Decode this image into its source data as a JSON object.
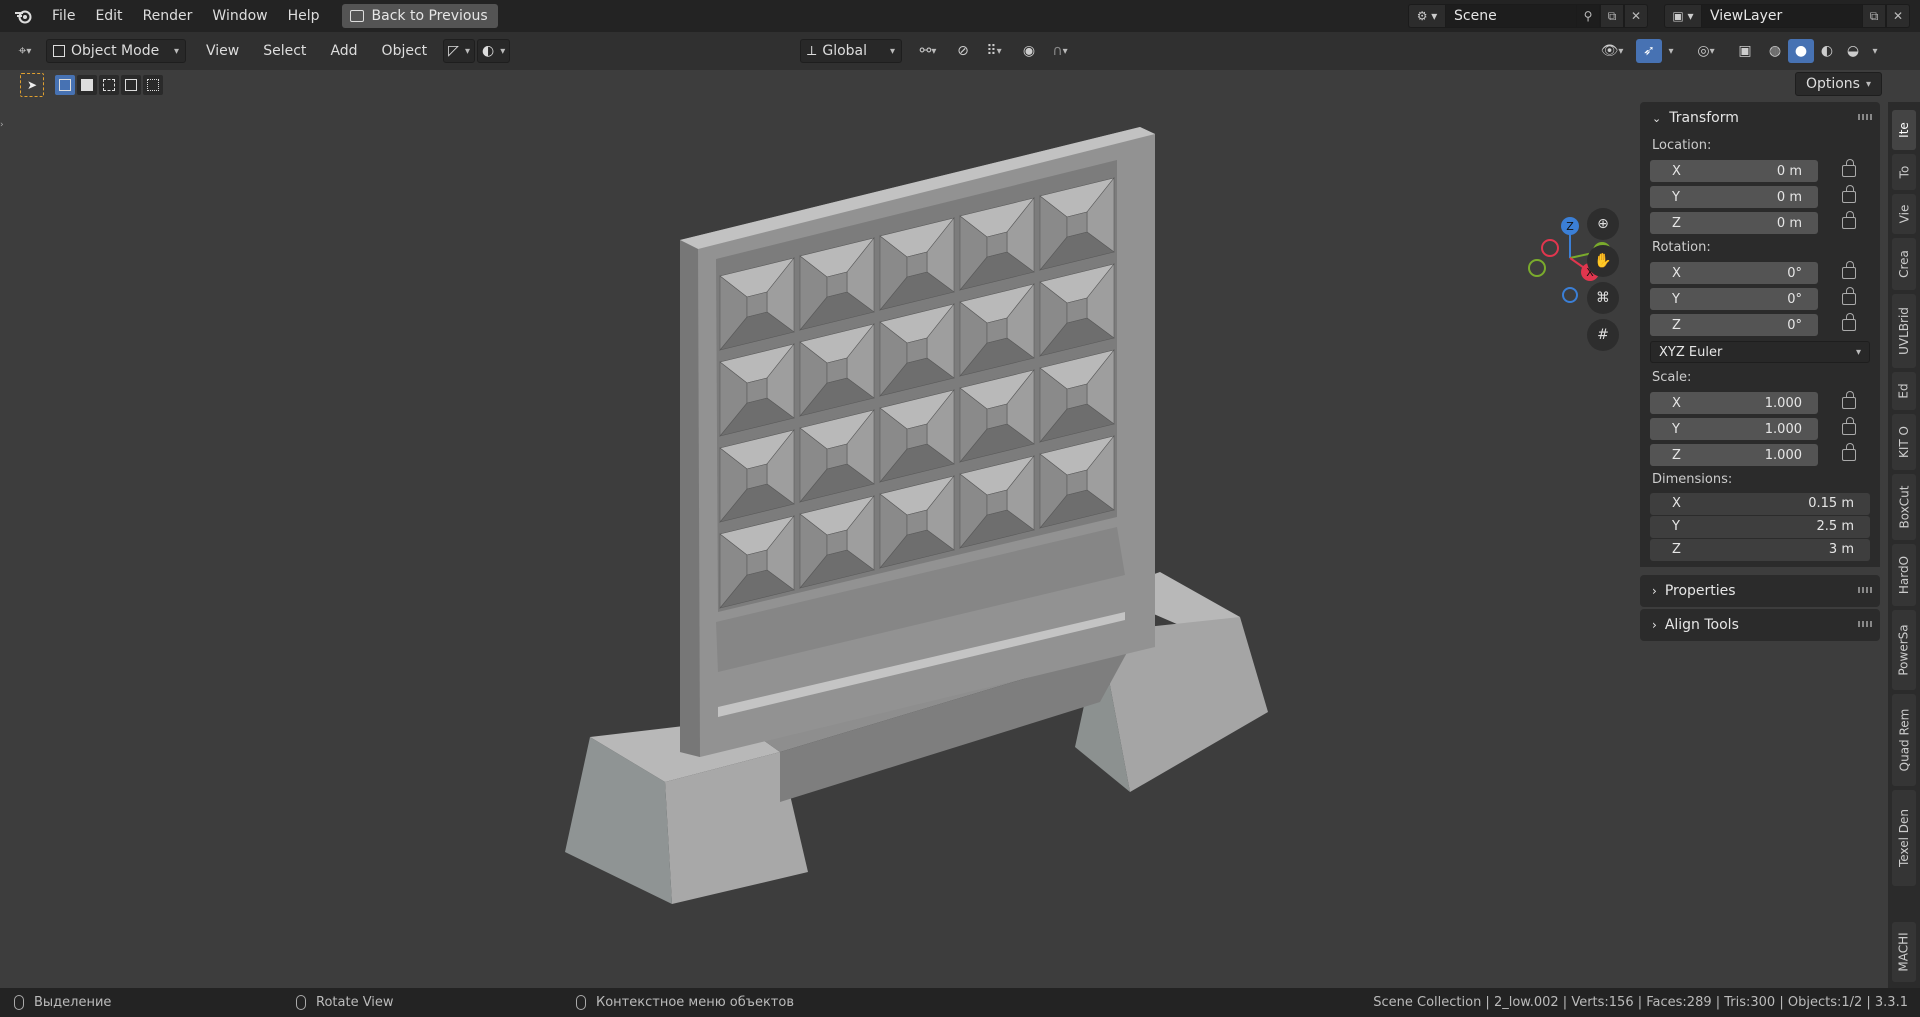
{
  "topbar": {
    "menu": [
      "File",
      "Edit",
      "Render",
      "Window",
      "Help"
    ],
    "back_label": "Back to Previous",
    "scene": "Scene",
    "view_layer": "ViewLayer"
  },
  "header": {
    "mode": "Object Mode",
    "menu": [
      "View",
      "Select",
      "Add",
      "Object"
    ],
    "orientation": "Global",
    "options": "Options"
  },
  "gizmo": {
    "x": "X",
    "y": "Y",
    "z": "Z"
  },
  "npanel": {
    "transform_title": "Transform",
    "location_label": "Location:",
    "location": [
      {
        "axis": "X",
        "value": "0 m"
      },
      {
        "axis": "Y",
        "value": "0 m"
      },
      {
        "axis": "Z",
        "value": "0 m"
      }
    ],
    "rotation_label": "Rotation:",
    "rotation": [
      {
        "axis": "X",
        "value": "0°"
      },
      {
        "axis": "Y",
        "value": "0°"
      },
      {
        "axis": "Z",
        "value": "0°"
      }
    ],
    "rotation_mode": "XYZ Euler",
    "scale_label": "Scale:",
    "scale": [
      {
        "axis": "X",
        "value": "1.000"
      },
      {
        "axis": "Y",
        "value": "1.000"
      },
      {
        "axis": "Z",
        "value": "1.000"
      }
    ],
    "dimensions_label": "Dimensions:",
    "dimensions": [
      {
        "axis": "X",
        "value": "0.15 m"
      },
      {
        "axis": "Y",
        "value": "2.5 m"
      },
      {
        "axis": "Z",
        "value": "3 m"
      }
    ],
    "properties_title": "Properties",
    "align_title": "Align Tools"
  },
  "sidetabs": [
    "Ite",
    "To",
    "Vie",
    "Crea",
    "UVLBrid",
    "Ed",
    "KIT O",
    "BoxCut",
    "HardO",
    "PowerSa",
    "Quad Rem",
    "Texel Den",
    "MACHI"
  ],
  "status": {
    "left": "Выделение",
    "middle": "Rotate View",
    "right": "Контекстное меню объектов",
    "stats": "Scene Collection | 2_low.002 | Verts:156 | Faces:289 | Tris:300 | Objects:1/2 | 3.3.1"
  }
}
